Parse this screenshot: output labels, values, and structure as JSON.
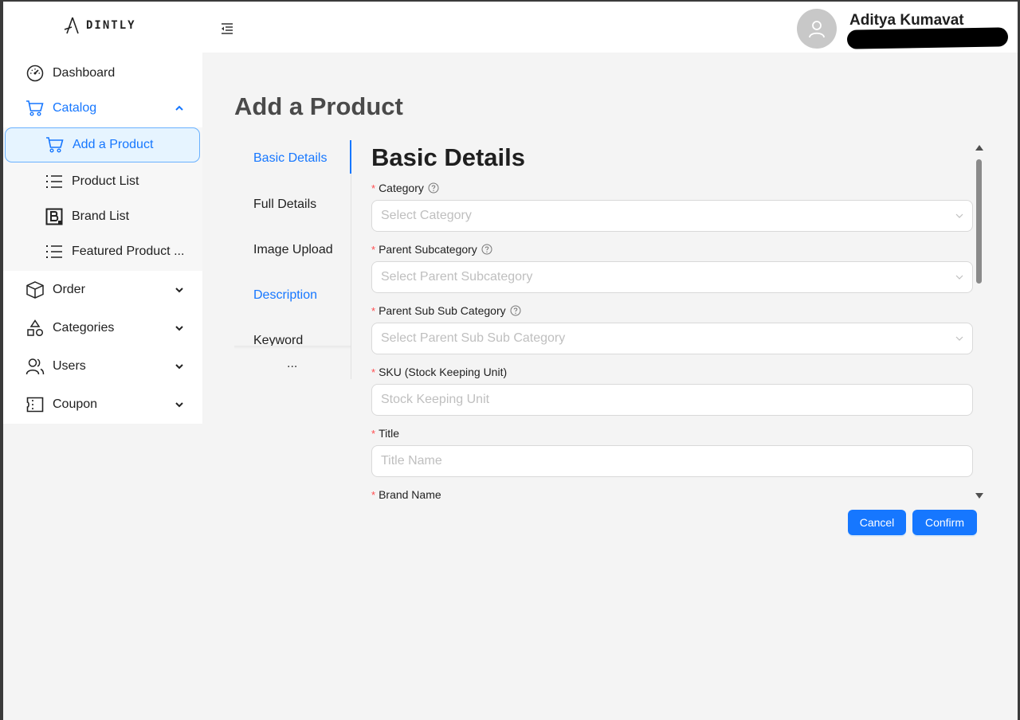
{
  "header": {
    "logo_text": "DINTLY",
    "user_name": "Aditya Kumavat"
  },
  "sidebar": {
    "items": [
      {
        "label": "Dashboard",
        "icon": "dashboard-icon"
      },
      {
        "label": "Catalog",
        "icon": "cart-icon",
        "expanded": true
      },
      {
        "label": "Order",
        "icon": "box-icon"
      },
      {
        "label": "Categories",
        "icon": "shapes-icon"
      },
      {
        "label": "Users",
        "icon": "users-icon"
      },
      {
        "label": "Coupon",
        "icon": "coupon-icon"
      }
    ],
    "catalog_children": [
      {
        "label": "Add a Product",
        "icon": "cart-icon",
        "active": true
      },
      {
        "label": "Product List",
        "icon": "list-icon"
      },
      {
        "label": "Brand List",
        "icon": "brand-icon"
      },
      {
        "label": "Featured Product ...",
        "icon": "list-icon"
      }
    ]
  },
  "main": {
    "page_title": "Add a Product",
    "tabs": [
      {
        "label": "Basic Details",
        "active": true
      },
      {
        "label": "Full Details"
      },
      {
        "label": "Image Upload"
      },
      {
        "label": "Description"
      },
      {
        "label": "Keyword"
      }
    ],
    "tabs_more": "...",
    "section_title": "Basic Details",
    "fields": [
      {
        "label": "Category",
        "placeholder": "Select Category",
        "type": "select",
        "help": true
      },
      {
        "label": "Parent Subcategory",
        "placeholder": "Select Parent Subcategory",
        "type": "select",
        "help": true
      },
      {
        "label": "Parent Sub Sub Category",
        "placeholder": "Select Parent Sub Sub Category",
        "type": "select",
        "help": true
      },
      {
        "label": "SKU (Stock Keeping Unit)",
        "placeholder": "Stock Keeping Unit",
        "type": "input"
      },
      {
        "label": "Title",
        "placeholder": "Title Name",
        "type": "input"
      },
      {
        "label": "Brand Name"
      }
    ],
    "required_mark": "*",
    "cancel_label": "Cancel",
    "confirm_label": "Confirm"
  },
  "colors": {
    "accent": "#1677ff",
    "active_bg": "#e6f4ff",
    "required": "#ff4d4f",
    "page_bg": "#f4f4f4"
  }
}
